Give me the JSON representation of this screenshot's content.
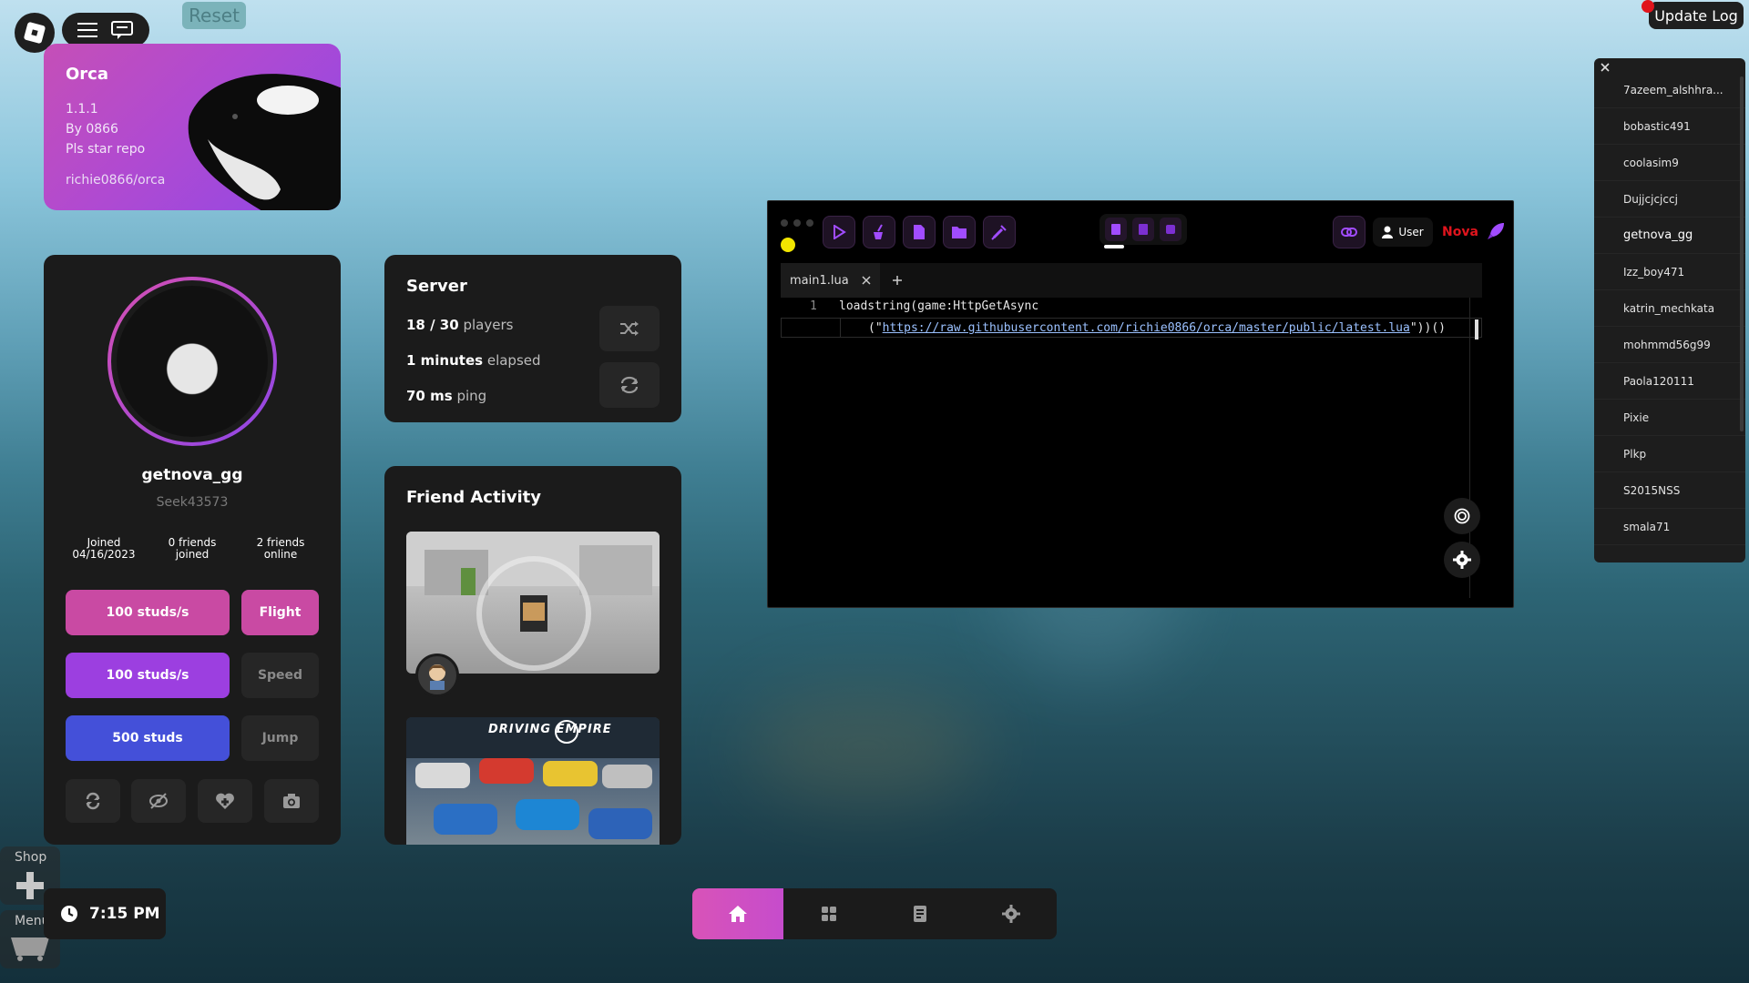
{
  "top": {
    "reset_label": "Reset",
    "update_log_label": "Update Log"
  },
  "banner": {
    "title": "Orca",
    "version": "1.1.1",
    "author": "By 0866",
    "tagline": "Pls star repo",
    "repo": "richie0866/orca"
  },
  "profile": {
    "display_name": "getnova_gg",
    "username": "Seek43573",
    "stats": [
      {
        "line1": "Joined",
        "line2": "04/16/2023"
      },
      {
        "line1": "0 friends",
        "line2": "joined"
      },
      {
        "line1": "2 friends",
        "line2": "online"
      }
    ],
    "controls": [
      {
        "value": "100 studs/s",
        "label": "Flight",
        "color": "#c94aa3",
        "side_active": true
      },
      {
        "value": "100 studs/s",
        "label": "Speed",
        "color": "#9c3fe0",
        "side_active": false
      },
      {
        "value": "500 studs",
        "label": "Jump",
        "color": "#4450d9",
        "side_active": false
      }
    ]
  },
  "server": {
    "title": "Server",
    "players_value": "18 / 30",
    "players_label": "players",
    "elapsed_value": "1 minutes",
    "elapsed_label": "elapsed",
    "ping_value": "70 ms",
    "ping_label": "ping"
  },
  "friends": {
    "title": "Friend Activity",
    "game2_logo": "DRIVING EMPIRE"
  },
  "clock": {
    "time": "7:15 PM"
  },
  "side_buttons": {
    "shop": "Shop",
    "menu": "Menu"
  },
  "editor": {
    "tab_name": "main1.lua",
    "user_label": "User",
    "brand": "Nova",
    "line_no": "1",
    "code_line1": "loadstring(game:HttpGetAsync",
    "code_open": "(\"",
    "code_url": "https://raw.githubusercontent.com/richie0866/orca/master/public/latest.lua",
    "code_close": "\"))()"
  },
  "players": [
    "7azeem_alshhra...",
    "bobastic491",
    "coolasim9",
    "Dujjcjcjccj",
    "getnova_gg",
    "Izz_boy471",
    "katrin_mechkata",
    "mohmmd56g99",
    "Paola120111",
    "Pixie",
    "Plkp",
    "S2015NSS",
    "smala71"
  ],
  "colors": {
    "accent_pink": "#d853b8",
    "accent_purple": "#8e46e8",
    "nova_red": "#e0141d"
  }
}
